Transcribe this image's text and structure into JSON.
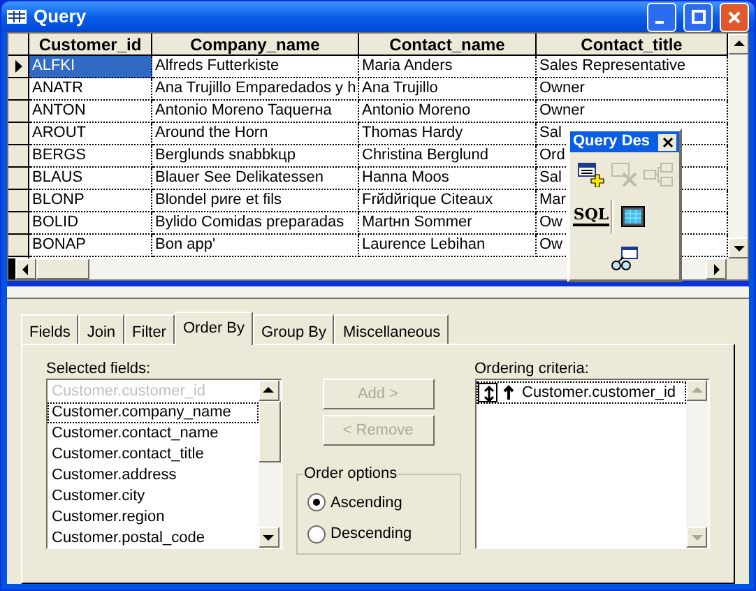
{
  "window": {
    "title": "Query"
  },
  "grid": {
    "columns": [
      "Customer_id",
      "Company_name",
      "Contact_name",
      "Contact_title"
    ],
    "rows": [
      {
        "selected": true,
        "cells": [
          "ALFKI",
          "Alfreds Futterkiste",
          "Maria Anders",
          "Sales Representative"
        ]
      },
      {
        "selected": false,
        "cells": [
          "ANATR",
          "Ana Trujillo Emparedados y h",
          "Ana Trujillo",
          "Owner"
        ]
      },
      {
        "selected": false,
        "cells": [
          "ANTON",
          "Antonio Moreno Taquerна",
          "Antonio Moreno",
          "Owner"
        ]
      },
      {
        "selected": false,
        "cells": [
          "AROUT",
          "Around the Horn",
          "Thomas Hardy",
          "Sal"
        ]
      },
      {
        "selected": false,
        "cells": [
          "BERGS",
          "Berglunds snabbkцp",
          "Christina Berglund",
          "Ord"
        ]
      },
      {
        "selected": false,
        "cells": [
          "BLAUS",
          "Blauer See Delikatessen",
          "Hanna Moos",
          "Sal"
        ]
      },
      {
        "selected": false,
        "cells": [
          "BLONP",
          "Blondel pиre et fils",
          "Frйdйrique Citeaux",
          "Mar"
        ]
      },
      {
        "selected": false,
        "cells": [
          "BOLID",
          "Bуlido Comidas preparadas",
          "Martнn Sommer",
          "Ow"
        ]
      },
      {
        "selected": false,
        "cells": [
          "BONAP",
          "Bon app'",
          "Laurence Lebihan",
          "Ow"
        ]
      }
    ]
  },
  "toolbar": {
    "title": "Query Des",
    "buttons": [
      {
        "kind": "add_table",
        "disabled": false
      },
      {
        "kind": "remove_table",
        "disabled": true
      },
      {
        "kind": "relations",
        "disabled": true
      },
      {
        "kind": "sql",
        "label": "SQL",
        "disabled": false
      },
      {
        "kind": "results",
        "disabled": false
      },
      {
        "kind": "preview",
        "disabled": false
      }
    ]
  },
  "tabs": [
    {
      "label": "Fields",
      "selected": false
    },
    {
      "label": "Join",
      "selected": false
    },
    {
      "label": "Filter",
      "selected": false
    },
    {
      "label": "Order By",
      "selected": true
    },
    {
      "label": "Group By",
      "selected": false
    },
    {
      "label": "Miscellaneous",
      "selected": false
    }
  ],
  "order_by": {
    "selected_fields_label": "Selected fields:",
    "selected_fields": [
      {
        "text": "Customer.customer_id",
        "disabled": true,
        "focused": false
      },
      {
        "text": "Customer.company_name",
        "disabled": false,
        "focused": true
      },
      {
        "text": "Customer.contact_name",
        "disabled": false,
        "focused": false
      },
      {
        "text": "Customer.contact_title",
        "disabled": false,
        "focused": false
      },
      {
        "text": "Customer.address",
        "disabled": false,
        "focused": false
      },
      {
        "text": "Customer.city",
        "disabled": false,
        "focused": false
      },
      {
        "text": "Customer.region",
        "disabled": false,
        "focused": false
      },
      {
        "text": "Customer.postal_code",
        "disabled": false,
        "focused": false
      }
    ],
    "add_button": {
      "label": "Add >",
      "disabled": true
    },
    "remove_button": {
      "label": "< Remove",
      "disabled": true
    },
    "order_options": {
      "label": "Order options",
      "options": [
        {
          "label": "Ascending",
          "selected": true
        },
        {
          "label": "Descending",
          "selected": false
        }
      ]
    },
    "ordering_criteria_label": "Ordering criteria:",
    "ordering_criteria": [
      {
        "text": "Customer.customer_id"
      }
    ]
  }
}
